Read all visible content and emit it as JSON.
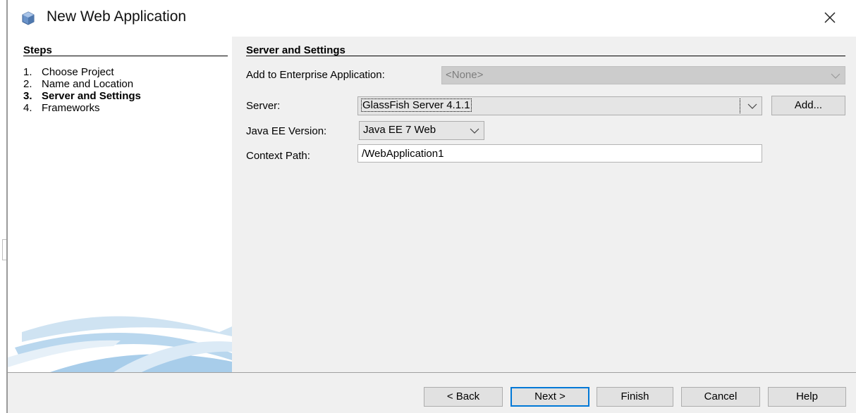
{
  "window": {
    "title": "New Web Application",
    "icon": "cube-icon",
    "close_icon": "close-icon"
  },
  "steps": {
    "heading": "Steps",
    "items": [
      {
        "num": "1.",
        "label": "Choose Project",
        "current": false
      },
      {
        "num": "2.",
        "label": "Name and Location",
        "current": false
      },
      {
        "num": "3.",
        "label": "Server and Settings",
        "current": true
      },
      {
        "num": "4.",
        "label": "Frameworks",
        "current": false
      }
    ]
  },
  "content": {
    "section_title": "Server and Settings",
    "enterprise_label": "Add to Enterprise Application:",
    "enterprise_value": "<None>",
    "server_label": "Server:",
    "server_value": "GlassFish Server 4.1.1",
    "add_button": "Add...",
    "java_ee_label": "Java EE Version:",
    "java_ee_value": "Java EE 7 Web",
    "context_path_label": "Context Path:",
    "context_path_value": "/WebApplication1"
  },
  "buttons": {
    "back": "< Back",
    "next": "Next >",
    "finish": "Finish",
    "cancel": "Cancel",
    "help": "Help"
  },
  "colors": {
    "accent": "#0078d7",
    "panel_bg": "#f0f0f0",
    "disabled_bg": "#cccccc"
  }
}
